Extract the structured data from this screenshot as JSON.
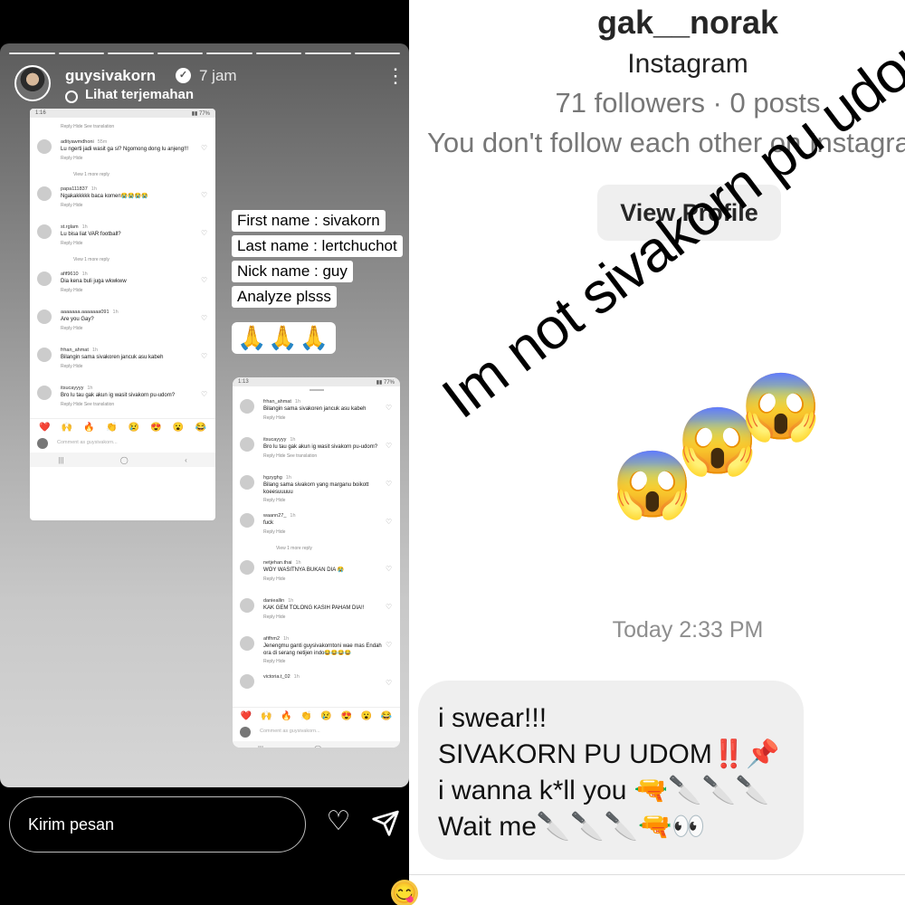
{
  "story": {
    "username": "guysivakorn",
    "time": "7 jam",
    "translate": "Lihat terjemahan",
    "reply_placeholder": "Kirim pesan",
    "stickers": [
      "First name : sivakorn",
      "Last name : lertchuchot",
      "Nick name : guy",
      "Analyze plsss"
    ],
    "emoji_sticker": "🙏🙏🙏",
    "phone1": {
      "status": "1:16",
      "top_actions": "Reply   Hide   See translation",
      "comments": [
        {
          "user": "adityawmdhoni",
          "time": "55m",
          "text": "Lu ngerti jadi wasit ga si? Ngomong dong lu anjeng!!!",
          "actions": "Reply   Hide",
          "more": "View 1 more reply"
        },
        {
          "user": "papa111837",
          "time": "1h",
          "text": "Ngakakkkkk baca komen😭😭😭😭",
          "actions": "Reply   Hide",
          "more": ""
        },
        {
          "user": "st.rglam",
          "time": "1h",
          "text": "Lu bisa liat VAR football?",
          "actions": "Reply   Hide",
          "more": "View 1 more reply"
        },
        {
          "user": "afif9610",
          "time": "1h",
          "text": "Dia kena buli juga wkwkww",
          "actions": "Reply   Hide",
          "more": ""
        },
        {
          "user": "aaaaaaa.aaaaaaa091",
          "time": "1h",
          "text": "Are you Gay?",
          "actions": "Reply   Hide",
          "more": ""
        },
        {
          "user": "frhan_ahmat",
          "time": "1h",
          "text": "Bilangin sama sivakoren jancuk asu kabeh",
          "actions": "Reply   Hide",
          "more": ""
        },
        {
          "user": "itsucayyyy",
          "time": "1h",
          "text": "Bro lu tau gak akun ig wasit sivakorn pu-udom?",
          "actions": "Reply   Hide   See translation",
          "more": ""
        }
      ],
      "emojis": [
        "❤️",
        "🙌",
        "🔥",
        "👏",
        "😢",
        "😍",
        "😮",
        "😂"
      ],
      "comment_placeholder": "Comment as guysivakorn...",
      "nav": [
        "|||",
        "◯",
        "‹"
      ]
    },
    "phone2": {
      "status": "1:13",
      "comments": [
        {
          "user": "frhan_ahmat",
          "time": "1h",
          "text": "Bilangin sama sivakoren jancuk asu kabeh",
          "actions": "Reply   Hide",
          "more": ""
        },
        {
          "user": "itsucayyyy",
          "time": "1h",
          "text": "Bro lu tau gak akun ig wasit sivakorn pu-udom?",
          "actions": "Reply   Hide   See translation",
          "more": ""
        },
        {
          "user": "hgzyghg",
          "time": "1h",
          "text": "Bilang sama sivakorn yang marganu boikott koeesuuuuu",
          "actions": "Reply   Hide",
          "more": ""
        },
        {
          "user": "waann27_",
          "time": "1h",
          "text": "fuck",
          "actions": "Reply   Hide",
          "more": "View 1 more reply"
        },
        {
          "user": "netjehan.thai",
          "time": "1h",
          "text": "WOY WASITNYA BUKAN DIA 😭",
          "actions": "Reply   Hide",
          "more": ""
        },
        {
          "user": "danieallin",
          "time": "1h",
          "text": "KAK GEM TOLONG KASIH PAHAM DIA!!",
          "actions": "Reply   Hide",
          "more": ""
        },
        {
          "user": "afifhm2",
          "time": "1h",
          "text": "Jenengmu ganti guysivakorntoni wae mas Endah ora di serang netijen indo😂😂😂😂",
          "actions": "Reply   Hide",
          "more": ""
        },
        {
          "user": "victoria.t_02",
          "time": "1h",
          "text": "",
          "actions": "",
          "more": ""
        }
      ],
      "emojis": [
        "❤️",
        "🙌",
        "🔥",
        "👏",
        "😢",
        "😍",
        "😮",
        "😂"
      ],
      "comment_placeholder": "Comment as guysivakorn...",
      "nav": [
        "|||",
        "◯",
        "‹"
      ]
    }
  },
  "dm": {
    "username": "gak__norak",
    "app": "Instagram",
    "stats": "71 followers · 0 posts",
    "follow_note": "You don't follow each other on Instagram",
    "view_profile": "View Profile",
    "overlay_text": "Im not sivakorn pu udom!!!",
    "overlay_emojis": "😱😱😱",
    "timestamp": "Today 2:33 PM",
    "message_lines": [
      "i swear!!!",
      "SIVAKORN PU UDOM‼️📌",
      "i wanna k*ll you 🔫🔪🔪🔪",
      "Wait me🔪🔪🔪🔫👀"
    ]
  }
}
